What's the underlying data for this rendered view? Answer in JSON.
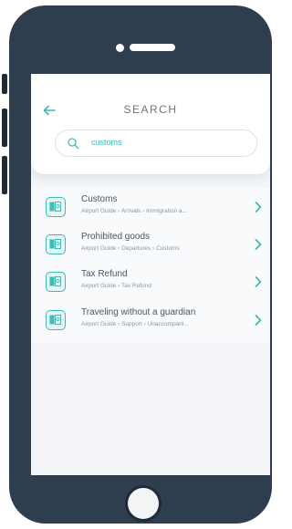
{
  "colors": {
    "accent": "#41b9b4",
    "device": "#2e3e4e",
    "screen_bg": "#f3f5f8"
  },
  "header": {
    "back_icon": "arrow-left-icon",
    "title": "SEARCH",
    "search": {
      "icon": "search-icon",
      "value": "customs"
    }
  },
  "results": [
    {
      "title": "Customs",
      "path": "Airport Guide › Arrivals › Immigration a...",
      "icon": "book-icon"
    },
    {
      "title": "Prohibited goods",
      "path": "Airport Guide › Departures › Customs",
      "icon": "book-icon"
    },
    {
      "title": "Tax Refund",
      "path": "Airport Guide › Tax Refund",
      "icon": "book-icon"
    },
    {
      "title": "Traveling without a guardian",
      "path": "Airport Guide › Support › Unaccompani...",
      "icon": "book-icon"
    }
  ]
}
